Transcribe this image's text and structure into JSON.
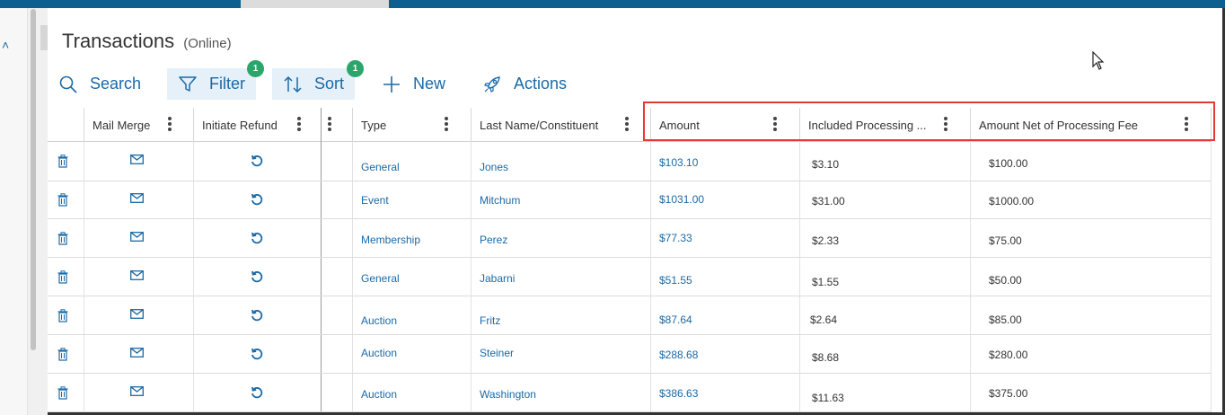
{
  "page": {
    "title": "Transactions",
    "subtitle": "(Online)"
  },
  "toolbar": {
    "search_label": "Search",
    "filter_label": "Filter",
    "filter_badge": "1",
    "sort_label": "Sort",
    "sort_badge": "1",
    "new_label": "New",
    "actions_label": "Actions"
  },
  "columns": {
    "mail_merge": "Mail Merge",
    "initiate_refund": "Initiate Refund",
    "type": "Type",
    "last_name": "Last Name/Constituent",
    "amount": "Amount",
    "included_fee": "Included Processing ...",
    "amount_net": "Amount Net of Processing Fee"
  },
  "rows": [
    {
      "type": "General",
      "name": "Jones",
      "amount": "$103.10",
      "fee": "$3.10",
      "net": "$100.00"
    },
    {
      "type": "Event",
      "name": "Mitchum",
      "amount": "$1031.00",
      "fee": "$31.00",
      "net": "$1000.00"
    },
    {
      "type": "Membership",
      "name": "Perez",
      "amount": "$77.33",
      "fee": "$2.33",
      "net": "$75.00"
    },
    {
      "type": "General",
      "name": "Jabarni",
      "amount": "$51.55",
      "fee": "$1.55",
      "net": "$50.00"
    },
    {
      "type": "Auction",
      "name": "Fritz",
      "amount": "$87.64",
      "fee": "$2.64",
      "net": "$85.00"
    },
    {
      "type": "Auction",
      "name": "Steiner",
      "amount": "$288.68",
      "fee": "$8.68",
      "net": "$280.00"
    },
    {
      "type": "Auction",
      "name": "Washington",
      "amount": "$386.63",
      "fee": "$11.63",
      "net": "$375.00"
    }
  ],
  "colors": {
    "accent": "#1a6aa8",
    "badge": "#2aa66a",
    "highlight": "#e53935",
    "topbar": "#0d5f8f"
  },
  "icons": [
    "search-icon",
    "filter-icon",
    "sort-icon",
    "plus-icon",
    "rocket-icon",
    "trash-icon",
    "envelope-icon",
    "refund-icon",
    "kebab-icon"
  ]
}
